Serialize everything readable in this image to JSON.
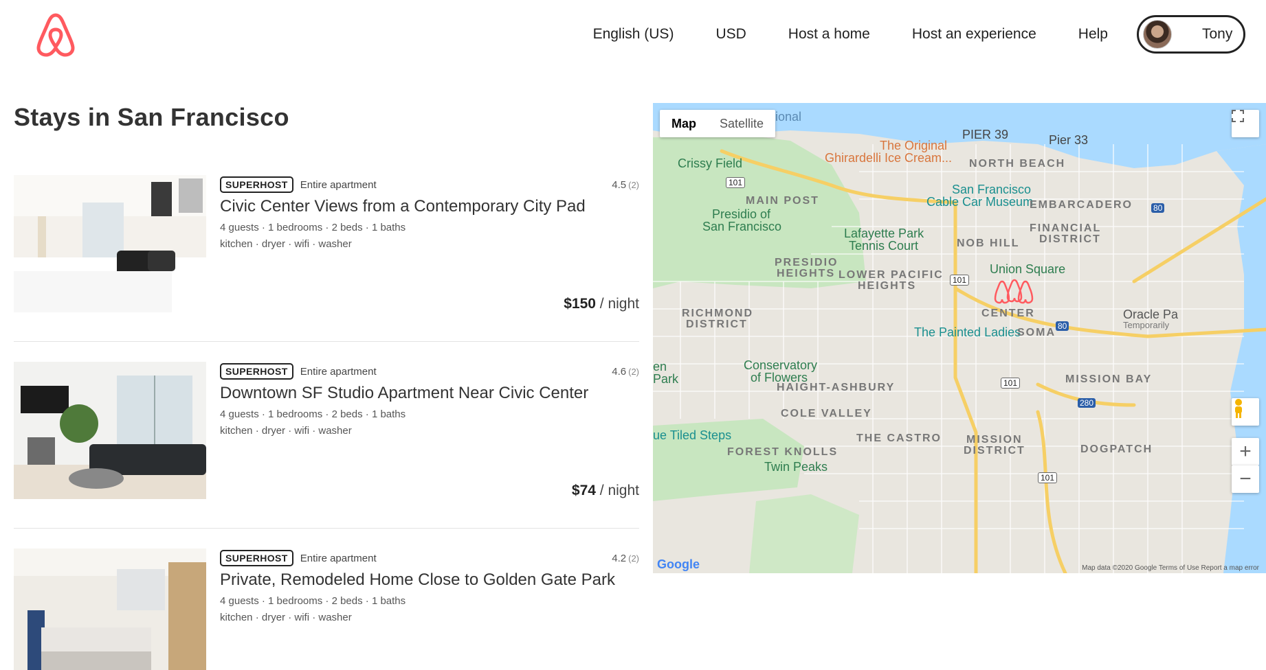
{
  "brand": {
    "color": "#FF5A5F"
  },
  "nav": {
    "language": "English (US)",
    "currency": "USD",
    "host_home": "Host a home",
    "host_experience": "Host an experience",
    "help": "Help",
    "user_name": "Tony"
  },
  "page_title": "Stays in San Francisco",
  "listings": [
    {
      "badge": "SUPERHOST",
      "type": "Entire apartment",
      "rating": "4.5",
      "reviews": "(2)",
      "title": "Civic Center Views from a Contemporary City Pad",
      "specs": "4 guests · 1 bedrooms · 2 beds · 1 baths",
      "amenities": "kitchen · dryer · wifi · washer",
      "price": "$150",
      "price_unit": "/ night"
    },
    {
      "badge": "SUPERHOST",
      "type": "Entire apartment",
      "rating": "4.6",
      "reviews": "(2)",
      "title": "Downtown SF Studio Apartment Near Civic Center",
      "specs": "4 guests · 1 bedrooms · 2 beds · 1 baths",
      "amenities": "kitchen · dryer · wifi · washer",
      "price": "$74",
      "price_unit": "/ night"
    },
    {
      "badge": "SUPERHOST",
      "type": "Entire apartment",
      "rating": "4.2",
      "reviews": "(2)",
      "title": "Private, Remodeled Home Close to Golden Gate Park",
      "specs": "4 guests · 1 bedrooms · 2 beds · 1 baths",
      "amenities": "kitchen · dryer · wifi · washer",
      "price": "",
      "price_unit": ""
    }
  ],
  "map": {
    "type_map": "Map",
    "type_satellite": "Satellite",
    "zoom_in": "+",
    "zoom_out": "−",
    "attribution": "Map data ©2020 Google   Terms of Use   Report a map error",
    "google": "Google",
    "labels": {
      "national": "National",
      "pier39": "PIER 39",
      "pier33": "Pier 33",
      "the_original": "The Original",
      "ghirardelli": "Ghirardelli Ice Cream...",
      "north_beach": "NORTH BEACH",
      "crissy": "Crissy Field",
      "main_post": "MAIN POST",
      "presidio1": "Presidio of",
      "presidio2": "San Francisco",
      "cable1": "San Francisco",
      "cable2": "Cable Car Museum",
      "embarcadero": "EMBARCADERO",
      "financial1": "FINANCIAL",
      "financial2": "DISTRICT",
      "lafayette1": "Lafayette Park",
      "lafayette2": "Tennis Court",
      "nob_hill": "NOB HILL",
      "presidio_h1": "PRESIDIO",
      "presidio_h2": "HEIGHTS",
      "lower_pac1": "LOWER PACIFIC",
      "lower_pac2": "HEIGHTS",
      "union_square": "Union Square",
      "richmond1": "RICHMOND",
      "richmond2": "DISTRICT",
      "center": "CENTER",
      "painted": "The Painted Ladies",
      "soma": "SOMA",
      "oracle1": "Oracle Pa",
      "oracle2": "Temporarily",
      "conservatory1": "Conservatory",
      "conservatory2": "of Flowers",
      "haight": "HAIGHT-ASHBURY",
      "mission_bay": "MISSION BAY",
      "cole_valley": "COLE VALLEY",
      "tiled": "ue Tiled Steps",
      "castro": "THE CASTRO",
      "mission1": "MISSION",
      "mission2": "DISTRICT",
      "forest": "FOREST KNOLLS",
      "twin": "Twin Peaks",
      "dogpatch": "DOGPATCH",
      "park1": "en",
      "park2": "Park",
      "hwy101": "101",
      "hwy80": "80",
      "hwy280": "280"
    }
  }
}
